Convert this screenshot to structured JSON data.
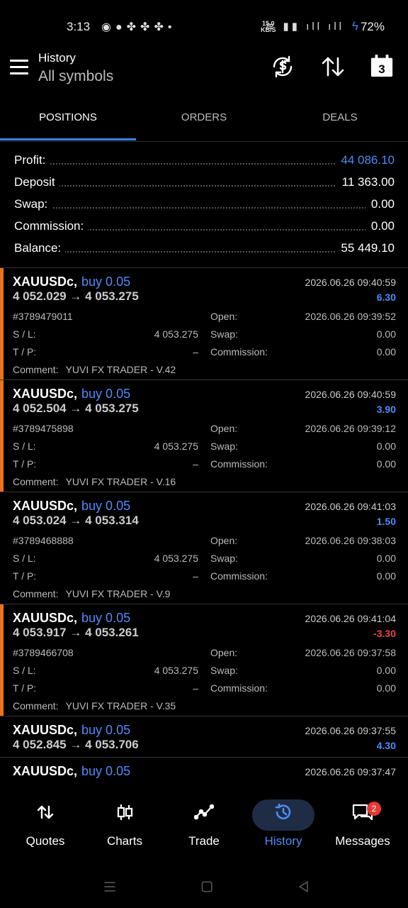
{
  "status": {
    "time": "3:13",
    "speed_top": "15.0",
    "speed_bottom": "KB/S",
    "battery": "72%"
  },
  "header": {
    "title": "History",
    "subtitle": "All symbols",
    "calendar_day": "3"
  },
  "tabs": [
    {
      "label": "POSITIONS"
    },
    {
      "label": "ORDERS"
    },
    {
      "label": "DEALS"
    }
  ],
  "summary": {
    "profit_label": "Profit:",
    "profit": "44 086.10",
    "deposit_label": "Deposit",
    "deposit": "11 363.00",
    "swap_label": "Swap:",
    "swap": "0.00",
    "commission_label": "Commission:",
    "commission": "0.00",
    "balance_label": "Balance:",
    "balance": "55 449.10"
  },
  "labels": {
    "sl": "S / L:",
    "tp": "T / P:",
    "open": "Open:",
    "swap": "Swap:",
    "commission": "Commission:",
    "comment": "Comment:"
  },
  "deals": [
    {
      "symbol": "XAUUSDc,",
      "type": "buy 0.05",
      "close_time": "2026.06.26 09:40:59",
      "prices": "4 052.029 → 4 053.275",
      "profit": "6.30",
      "ticket": "#3789479011",
      "open_time": "2026.06.26 09:39:52",
      "sl": "4 053.275",
      "tp": "–",
      "swap": "0.00",
      "commission": "0.00",
      "comment": "YUVI FX TRADER - V.42"
    },
    {
      "symbol": "XAUUSDc,",
      "type": "buy 0.05",
      "close_time": "2026.06.26 09:40:59",
      "prices": "4 052.504 → 4 053.275",
      "profit": "3.90",
      "ticket": "#3789475898",
      "open_time": "2026.06.26 09:39:12",
      "sl": "4 053.275",
      "tp": "–",
      "swap": "0.00",
      "commission": "0.00",
      "comment": "YUVI FX TRADER - V.16"
    },
    {
      "symbol": "XAUUSDc,",
      "type": "buy 0.05",
      "close_time": "2026.06.26 09:41:03",
      "prices": "4 053.024 → 4 053.314",
      "profit": "1.50",
      "ticket": "#3789468888",
      "open_time": "2026.06.26 09:38:03",
      "sl": "4 053.275",
      "tp": "–",
      "swap": "0.00",
      "commission": "0.00",
      "comment": "YUVI FX TRADER - V.9"
    },
    {
      "symbol": "XAUUSDc,",
      "type": "buy 0.05",
      "close_time": "2026.06.26 09:41:04",
      "prices": "4 053.917 → 4 053.261",
      "profit": "-3.30",
      "ticket": "#3789466708",
      "open_time": "2026.06.26 09:37:58",
      "sl": "4 053.275",
      "tp": "–",
      "swap": "0.00",
      "commission": "0.00",
      "comment": "YUVI FX TRADER - V.35"
    },
    {
      "symbol": "XAUUSDc,",
      "type": "buy 0.05",
      "close_time": "2026.06.26 09:37:55",
      "prices": "4 052.845 → 4 053.706",
      "profit": "4.30"
    },
    {
      "symbol": "XAUUSDc,",
      "type": "buy 0.05",
      "close_time": "2026.06.26 09:37:47"
    }
  ],
  "nav": [
    {
      "label": "Quotes",
      "icon": "quotes-icon"
    },
    {
      "label": "Charts",
      "icon": "charts-icon"
    },
    {
      "label": "Trade",
      "icon": "trade-icon"
    },
    {
      "label": "History",
      "icon": "history-icon"
    },
    {
      "label": "Messages",
      "icon": "messages-icon",
      "badge": "2"
    }
  ],
  "colors": {
    "accent": "#4f8cf7",
    "tab_indicator": "#3b82f6",
    "negative": "#ef4444",
    "open_marker": "#e8731b",
    "badge": "#e53935"
  }
}
